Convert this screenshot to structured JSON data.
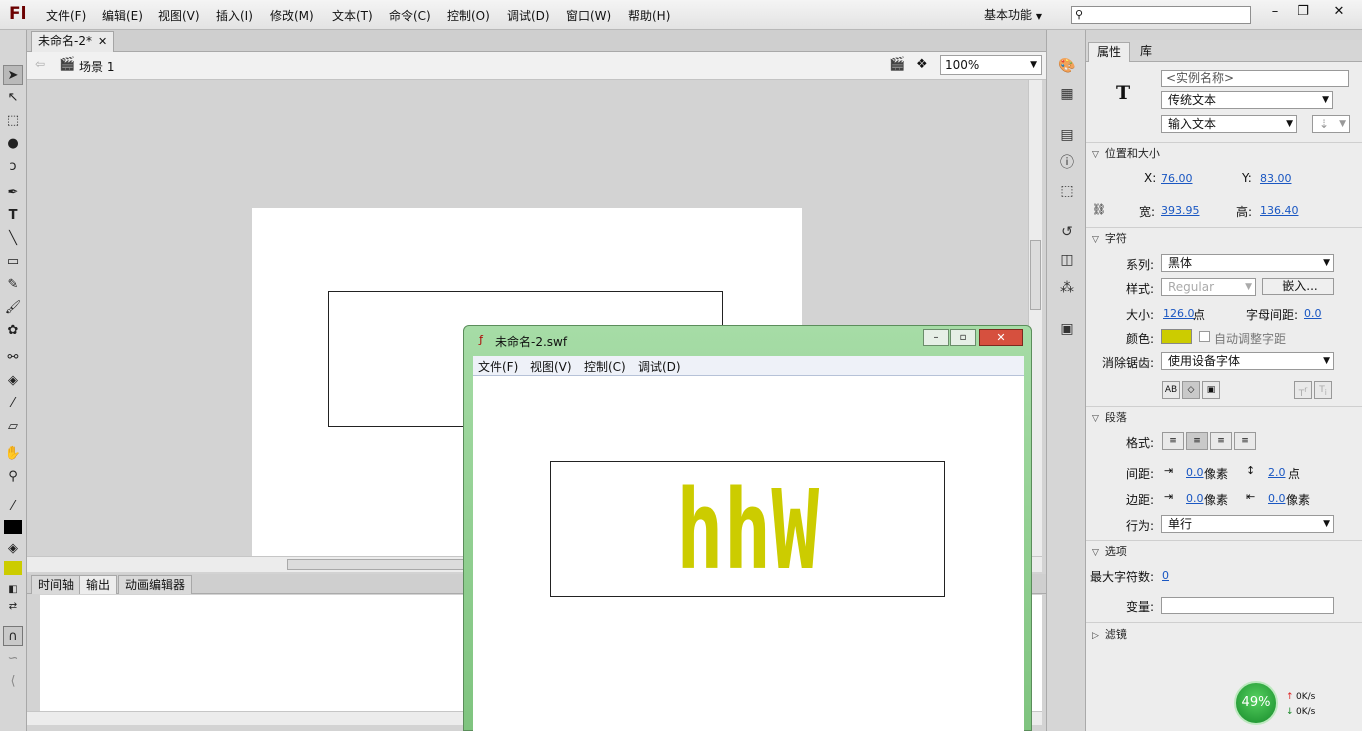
{
  "app": {
    "logo": "Fl",
    "workspace": "基本功能"
  },
  "menu": [
    "文件(F)",
    "编辑(E)",
    "视图(V)",
    "插入(I)",
    "修改(M)",
    "文本(T)",
    "命令(C)",
    "控制(O)",
    "调试(D)",
    "窗口(W)",
    "帮助(H)"
  ],
  "window_buttons": {
    "minimize": "–",
    "restore": "❐",
    "close": "✕"
  },
  "document": {
    "tab": "未命名-2*",
    "scene": "场景 1",
    "zoom": "100%"
  },
  "bottom_tabs": [
    "时间轴",
    "输出",
    "动画编辑器"
  ],
  "props": {
    "tabs": [
      "属性",
      "库"
    ],
    "type_glyph": "T",
    "instance_name_placeholder": "<实例名称>",
    "text_engine": "传统文本",
    "text_type": "输入文本",
    "pos_section": "位置和大小",
    "x_label": "X:",
    "x": "76.00",
    "y_label": "Y:",
    "y": "83.00",
    "w_label": "宽:",
    "w": "393.95",
    "h_label": "高:",
    "h": "136.40",
    "char_section": "字符",
    "family_label": "系列:",
    "family": "黑体",
    "style_label": "样式:",
    "style": "Regular",
    "embed": "嵌入...",
    "size_label": "大小:",
    "size": "126.0",
    "size_unit": "点",
    "spacing_label": "字母间距:",
    "spacing": "0.0",
    "color_label": "颜色:",
    "color": "#cccc00",
    "autokern": "自动调整字距",
    "aa_label": "消除锯齿:",
    "aa": "使用设备字体",
    "para_section": "段落",
    "format_label": "格式:",
    "gap_label": "间距:",
    "indent": "0.0",
    "px": "像素",
    "linespace": "2.0",
    "pt": "点",
    "margin_label": "边距:",
    "margin_l": "0.0",
    "margin_r": "0.0",
    "behavior_label": "行为:",
    "behavior": "单行",
    "options_section": "选项",
    "maxchars_label": "最大字符数:",
    "maxchars": "0",
    "var_label": "变量:",
    "filter_section": "滤镜"
  },
  "swf": {
    "title": "未命名-2.swf",
    "menu": [
      "文件(F)",
      "视图(V)",
      "控制(C)",
      "调试(D)"
    ],
    "text": "hhW",
    "text_color": "#cccc00"
  },
  "net": {
    "percent": "49%",
    "up": "0K/s",
    "down": "0K/s"
  }
}
